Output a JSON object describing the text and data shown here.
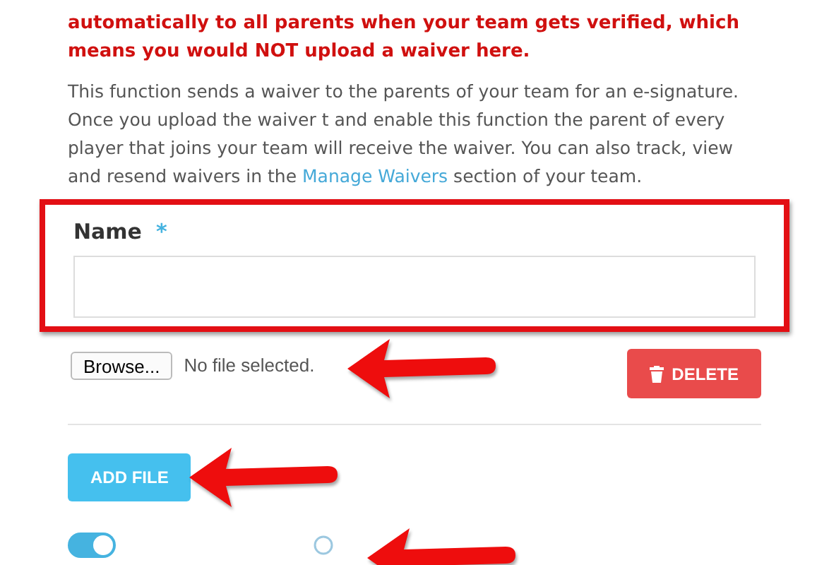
{
  "notice": "automatically to all parents when your team gets verified, which means you would NOT upload a waiver here.",
  "description": {
    "text": "This function sends a waiver to the parents of your team for an e-signature. Once you upload the waiver t and enable this function the parent of every player that joins your team will receive the waiver. You can also track, view and resend waivers in the",
    "link": "Manage Waivers",
    "after": "section of your team."
  },
  "name_field": {
    "label": "Name",
    "required_mark": "*",
    "highlighted": true
  },
  "file": {
    "browse_button": "Browse...",
    "status": "No file selected."
  },
  "delete_button": "DELETE",
  "add_button": "ADD FILE",
  "toggle": {
    "on": true
  },
  "annotations": [
    {
      "kind": "arrow"
    },
    {
      "kind": "arrow"
    },
    {
      "kind": "arrow"
    }
  ]
}
